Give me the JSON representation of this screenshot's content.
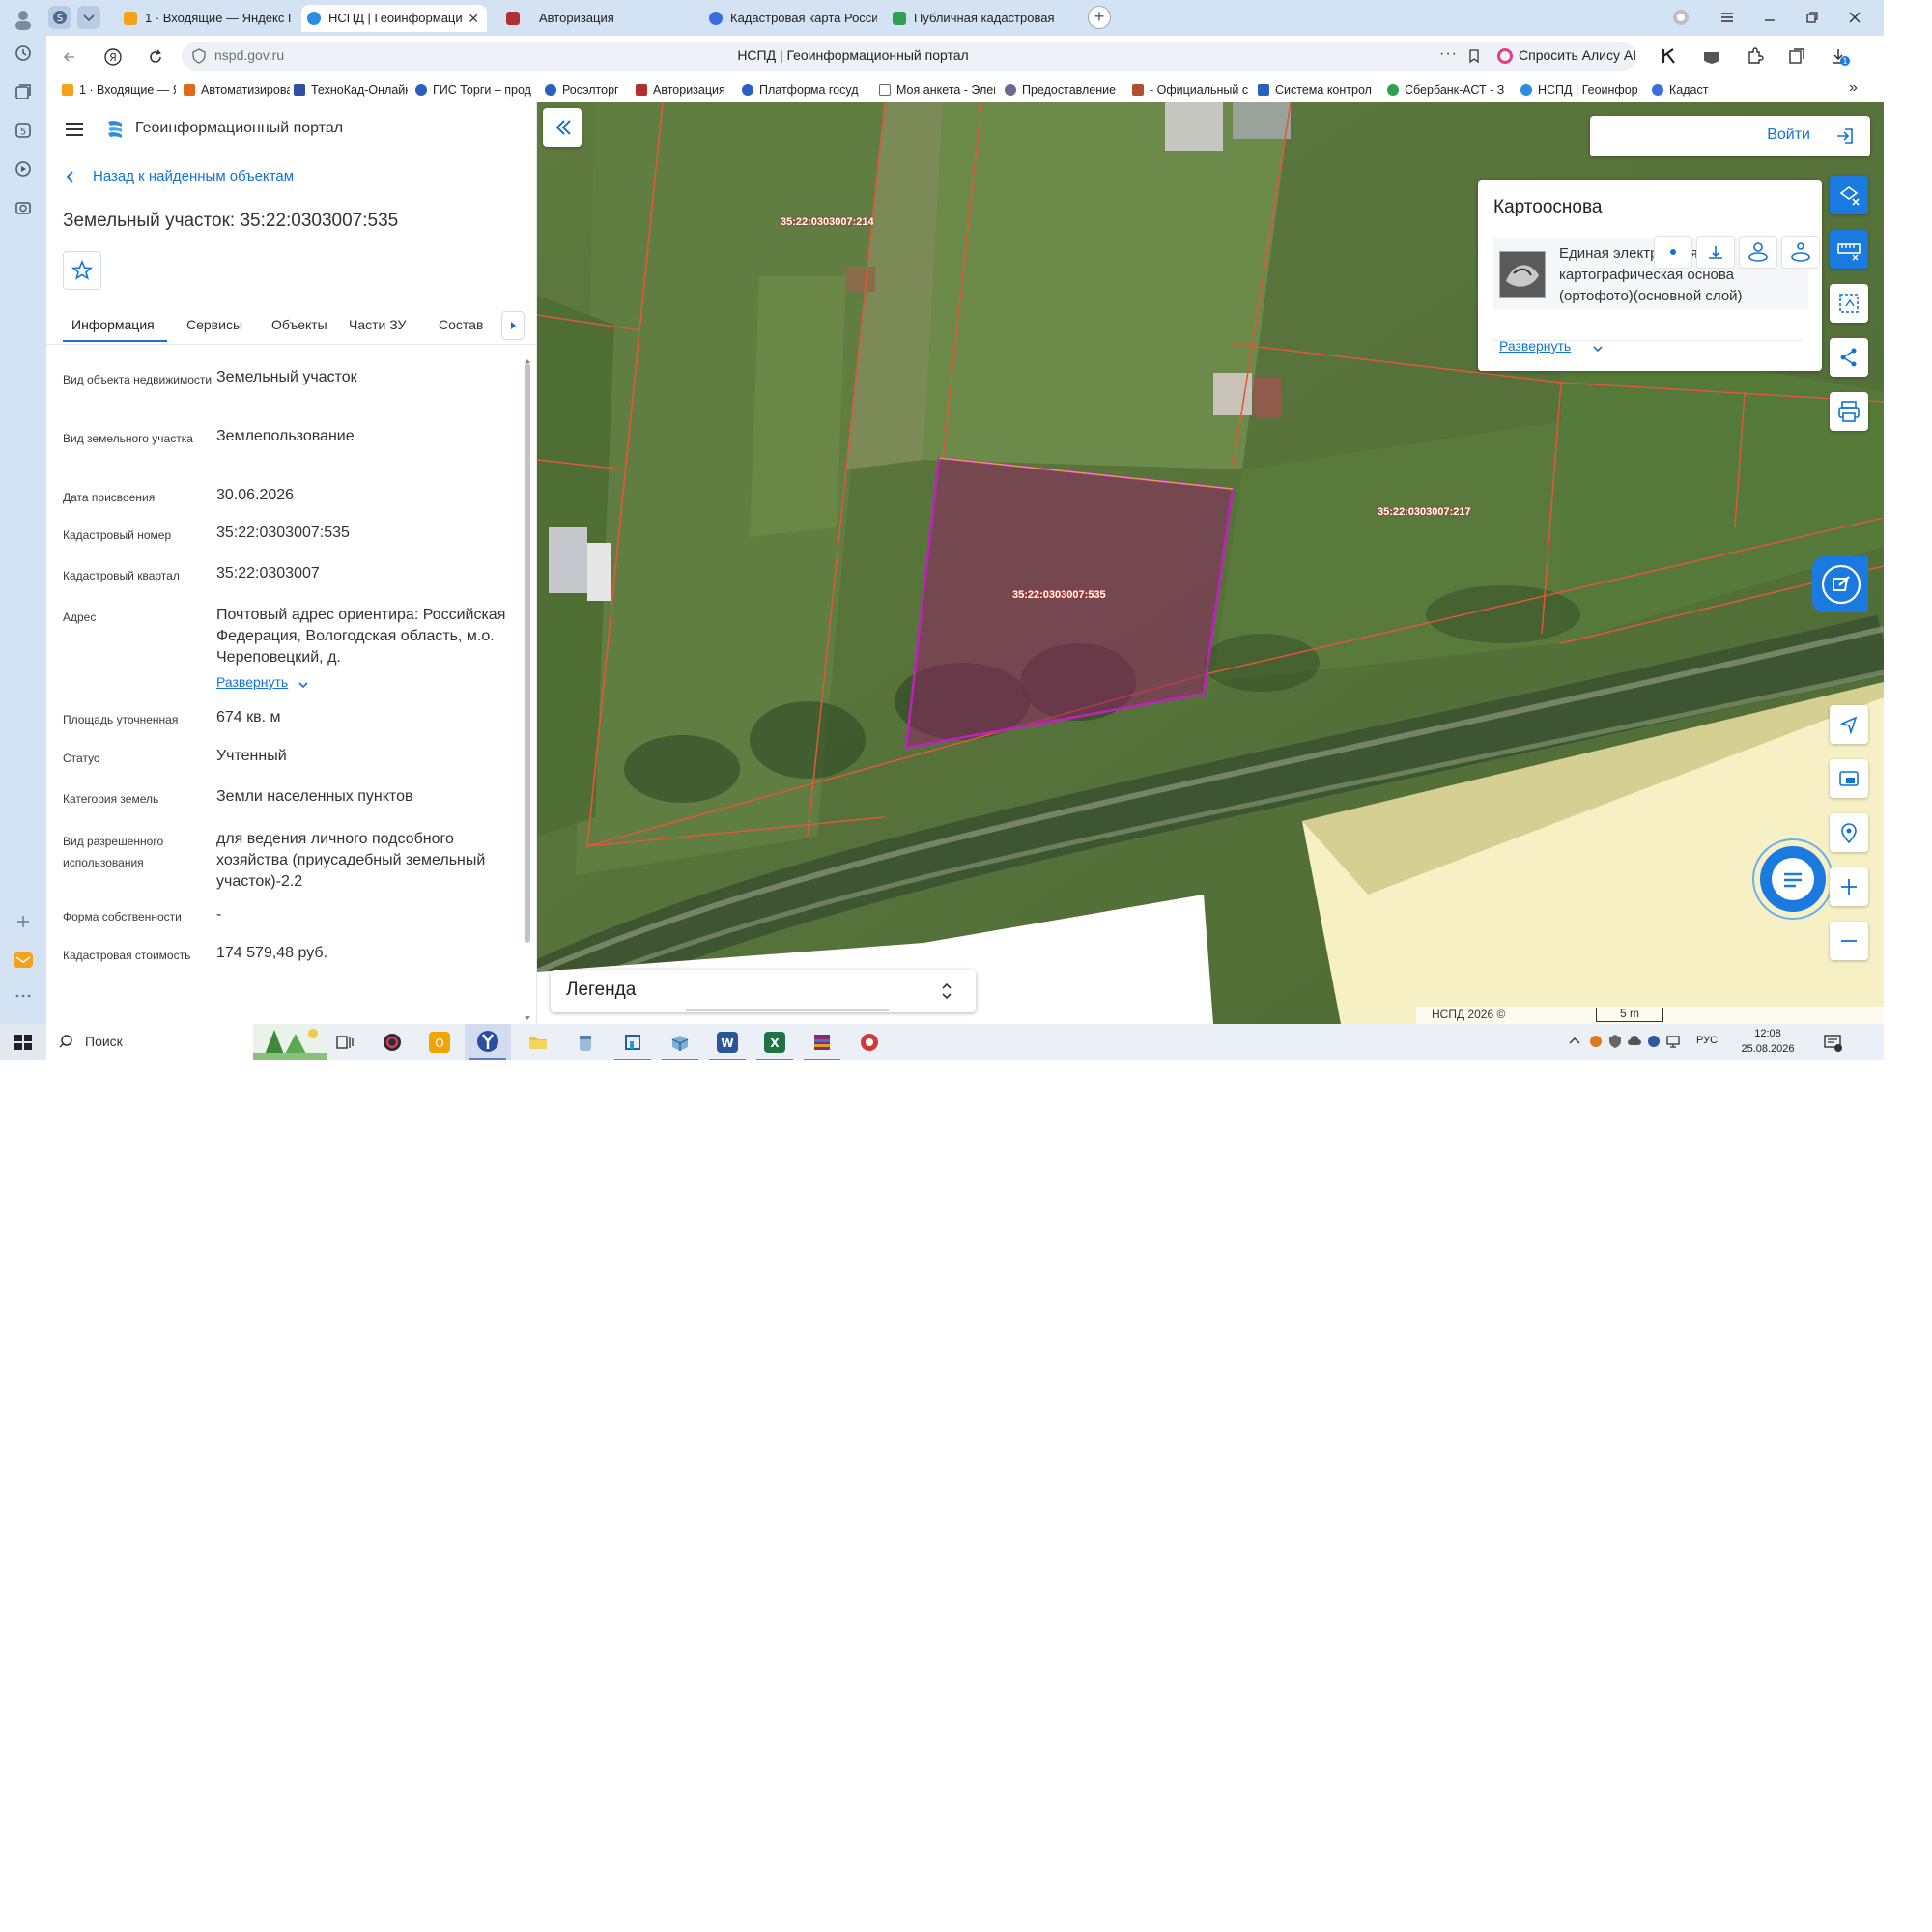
{
  "browser": {
    "tabs": [
      {
        "label": "1 · Входящие — Яндекс П",
        "color": "#f4a21a"
      },
      {
        "label": "НСПД | Геоинформаци",
        "color": "#2a8de0",
        "active": true
      },
      {
        "label": "Авторизация",
        "color": "#b03030"
      },
      {
        "label": "Кадастровая карта Росси",
        "color": "#3a6ee0"
      },
      {
        "label": "Публичная кадастровая",
        "color": "#2ea052"
      }
    ],
    "profile_badge": "S",
    "url": "nspd.gov.ru",
    "page_title": "НСПД | Геоинформационный портал",
    "ask_alice": "Спросить Алису AI",
    "download_badge": "1",
    "bookmarks": [
      {
        "label": "1 · Входящие — Я",
        "color": "#f4a21a"
      },
      {
        "label": "Автоматизирова",
        "color": "#e06a1a"
      },
      {
        "label": "ТехноКад-Онлайн",
        "color": "#2f4fa0"
      },
      {
        "label": "ГИС Торги – прод",
        "color": "#2a60c0"
      },
      {
        "label": "Росэлторг",
        "color": "#2a60c0"
      },
      {
        "label": "Авторизация",
        "color": "#b03030"
      },
      {
        "label": "Платформа госуд",
        "color": "#2a60c0"
      },
      {
        "label": "Моя анкета - Элек",
        "color": "#666666"
      },
      {
        "label": "Предоставление",
        "color": "#6a6a90"
      },
      {
        "label": "- Официальный с",
        "color": "#b05030"
      },
      {
        "label": "Система контрол",
        "color": "#2a60c0"
      },
      {
        "label": "Сбербанк-АСТ - З",
        "color": "#2ea052"
      },
      {
        "label": "НСПД | Геоинфор",
        "color": "#2a8de0"
      },
      {
        "label": "Кадаст",
        "color": "#3a6ee0"
      }
    ],
    "more": "»"
  },
  "portal": {
    "title": "Геоинформационный портал",
    "back_link": "Назад к найденным объектам",
    "object_title": "Земельный участок: 35:22:0303007:535",
    "tabs": [
      "Информация",
      "Сервисы",
      "Объекты",
      "Части ЗУ",
      "Состав"
    ],
    "fields": [
      {
        "label": "Вид объекта недвижимости",
        "value": "Земельный участок"
      },
      {
        "label": "Вид земельного участка",
        "value": "Землепользование"
      },
      {
        "label": "Дата присвоения",
        "value": "30.06.2026"
      },
      {
        "label": "Кадастровый номер",
        "value": "35:22:0303007:535"
      },
      {
        "label": "Кадастровый квартал",
        "value": "35:22:0303007"
      },
      {
        "label": "Адрес",
        "value": "Почтовый адрес ориентира: Российская Федерация, Вологодская область, м.о. Череповецкий, д."
      },
      {
        "label": "Площадь уточненная",
        "value": "674 кв. м"
      },
      {
        "label": "Статус",
        "value": "Учтенный"
      },
      {
        "label": "Категория земель",
        "value": "Земли населенных пунктов"
      },
      {
        "label": "Вид разрешенного использования",
        "value": "для ведения личного подсобного хозяйства (приусадебный земельный участок)-2.2"
      },
      {
        "label": "Форма собственности",
        "value": "-"
      },
      {
        "label": "Кадастровая стоимость",
        "value": "174 579,48 руб."
      }
    ],
    "expand_link": "Развернуть"
  },
  "map": {
    "login": "Войти",
    "basemap": {
      "title": "Картооснова",
      "layer_name": "Единая электронная картографическая основа (ортофото)(основной слой)",
      "expand": "Развернуть"
    },
    "parcel_labels": {
      "selected": "35:22:0303007:535",
      "north": "35:22:0303007:214",
      "east": "35:22:0303007:217"
    },
    "legend": "Легенда",
    "attribution": "НСПД 2026 ©",
    "scale": "5 m"
  },
  "taskbar": {
    "search": "Поиск",
    "lang": "РУС",
    "time": "12:08",
    "date": "25.08.2026"
  }
}
